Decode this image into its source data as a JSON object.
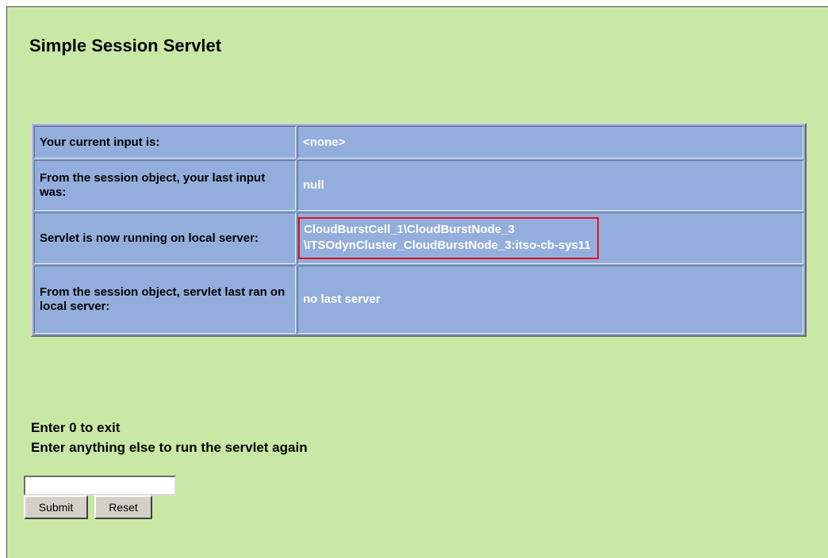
{
  "page": {
    "title": "Simple Session Servlet"
  },
  "session_table": {
    "rows": [
      {
        "label": "Your current input is:",
        "value": "<none>"
      },
      {
        "label": "From the session object, your last input was:",
        "value": "null"
      },
      {
        "label": "Servlet is now running on local server:",
        "value_lines": [
          "CloudBurstCell_1\\CloudBurstNode_3",
          "\\ITSOdynCluster_CloudBurstNode_3:itso-cb-sys11"
        ]
      },
      {
        "label": "From the session object, servlet last ran on local server:",
        "value": "no last server"
      }
    ]
  },
  "prompt": {
    "line1": "Enter 0 to exit",
    "line2": "Enter anything else to run the servlet again"
  },
  "form": {
    "input_value": "",
    "submit_label": "Submit",
    "reset_label": "Reset"
  },
  "colors": {
    "page_background": "#c9e8a5",
    "table_cell": "#93aedc",
    "highlight_border": "#e0141e"
  }
}
